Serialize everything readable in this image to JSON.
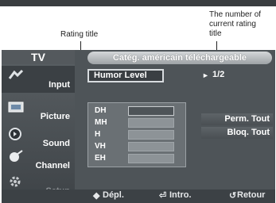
{
  "annotations": {
    "rating_title": "Rating title",
    "current_number_lines": [
      "The number of",
      "current rating",
      "title"
    ]
  },
  "sidebar": {
    "title": "TV",
    "items": [
      {
        "label": "Input",
        "icon": "input-icon"
      },
      {
        "label": "Picture",
        "icon": "picture-icon"
      },
      {
        "label": "Sound",
        "icon": "sound-icon"
      },
      {
        "label": "Channel",
        "icon": "channel-icon"
      },
      {
        "label": "Setup",
        "icon": "setup-icon"
      }
    ]
  },
  "main": {
    "title": "Catég. américain téléchargeable",
    "rating_title": "Humor Level",
    "rating_count": "1/2",
    "rows": [
      "DH",
      "MH",
      "H",
      "VH",
      "EH"
    ],
    "buttons": [
      "Perm. Tout",
      "Bloq. Tout"
    ]
  },
  "footer": {
    "move": "Dépl.",
    "enter": "Intro.",
    "return": "Retour"
  }
}
